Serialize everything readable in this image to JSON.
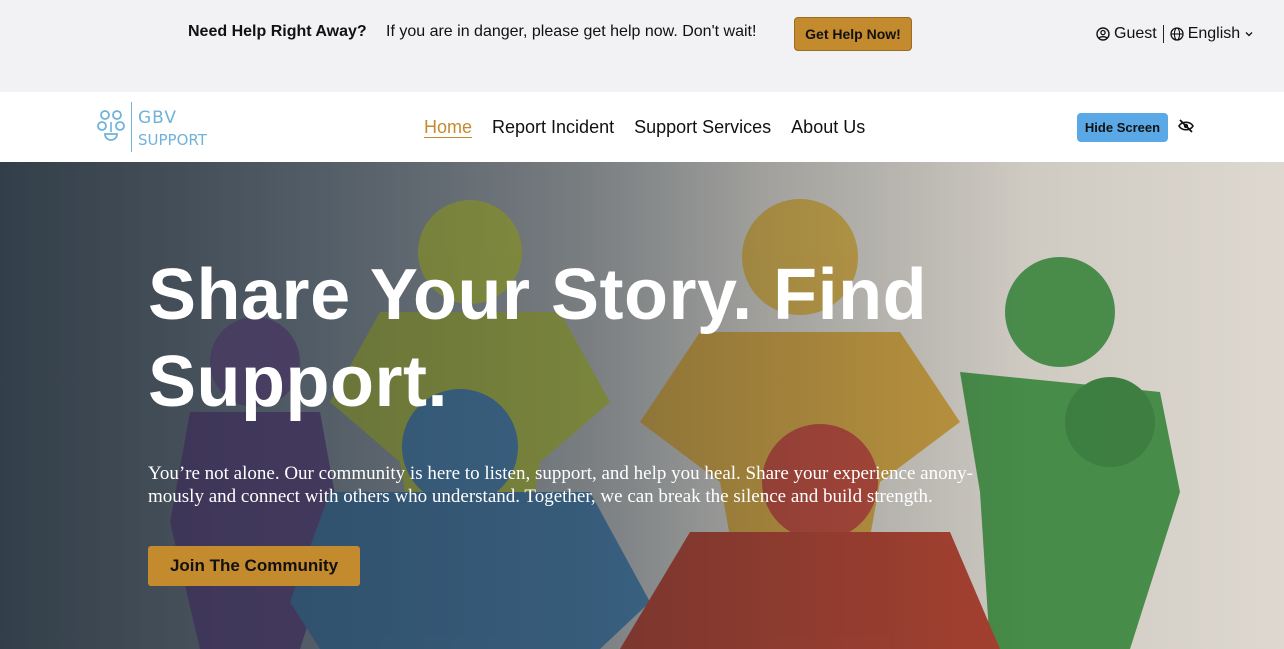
{
  "alert": {
    "title": "Need Help Right Away?",
    "text": "If you are in danger, please get help now. Don't wait!",
    "button": "Get Help Now!"
  },
  "user": {
    "account_label": "Guest",
    "language_label": "English",
    "account_icon": "user-circle-icon",
    "language_icon": "globe-icon"
  },
  "logo": {
    "line1": "GBV",
    "line2": "SUPPORT"
  },
  "nav": {
    "items": [
      "Home",
      "Report Incident",
      "Support Services",
      "About Us"
    ],
    "active": "Home"
  },
  "hide_screen": {
    "label": "Hide Screen",
    "icon": "eye-off-icon"
  },
  "hero": {
    "title": "Share Your Story. Find Support.",
    "text": "You’re not alone. Our community is here to listen, support, and help you heal. Share your experience anony-mously and connect with others who understand. Together, we can break the silence and build strength.",
    "button": "Join The Community"
  },
  "colors": {
    "accent": "#c48a2e",
    "hide_button": "#5aa9e6",
    "logo": "#6fb3d9",
    "alert_bg": "#f2f2f4"
  }
}
